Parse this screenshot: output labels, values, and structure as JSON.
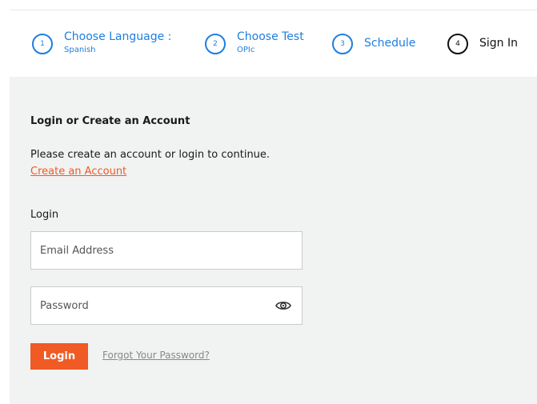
{
  "steps": [
    {
      "number": "1",
      "label": "Choose Language :",
      "sub": "Spanish"
    },
    {
      "number": "2",
      "label": "Choose Test",
      "sub": "OPIc"
    },
    {
      "number": "3",
      "label": "Schedule",
      "sub": ""
    },
    {
      "number": "4",
      "label": "Sign In",
      "sub": ""
    }
  ],
  "active_step": "4",
  "login": {
    "title": "Login or Create an Account",
    "description": "Please create an account or login to continue.",
    "create_account_link": "Create an Account",
    "section_label": "Login",
    "email_placeholder": "Email Address",
    "password_placeholder": "Password",
    "login_button": "Login",
    "forgot_link": "Forgot Your Password?"
  },
  "icons": {
    "password_toggle": "eye-icon"
  },
  "colors": {
    "accent": "#f05a24",
    "step_blue": "#1f7ee0",
    "panel_bg": "#f1f2f2"
  }
}
